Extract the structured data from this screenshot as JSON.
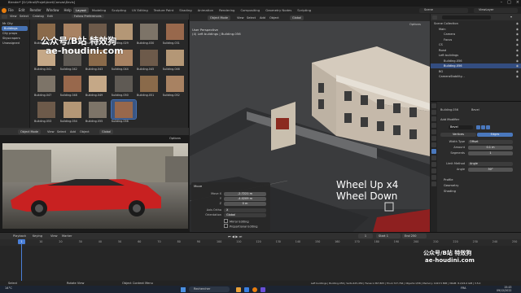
{
  "window": {
    "title": "Blender* [D:\\Vitrail\\Projet\\Anet\\Canvas\\Devis]"
  },
  "menu": {
    "items": [
      "File",
      "Edit",
      "Render",
      "Window",
      "Help"
    ],
    "workspaces": [
      "Layout",
      "Modeling",
      "Sculpting",
      "UV Editing",
      "Texture Paint",
      "Shading",
      "Animation",
      "Rendering",
      "Compositing",
      "Geometry Nodes",
      "Scripting"
    ],
    "active_workspace": "Layout",
    "scene": "Scene",
    "view_layer": "ViewLayer"
  },
  "asset_browser": {
    "header": [
      "View",
      "Select",
      "Catalog",
      "Edit"
    ],
    "library": "Follow Preferences",
    "library_dropdown": "Mr City",
    "catalogs": [
      "Buildings",
      "City props",
      "Skyscrapers",
      "Unassigned"
    ],
    "active_catalog": "Buildings",
    "thumbs": [
      {
        "label": "Building.026"
      },
      {
        "label": "Building.027"
      },
      {
        "label": "Building.028"
      },
      {
        "label": "Building.029"
      },
      {
        "label": "Building.030"
      },
      {
        "label": "Building.031"
      },
      {
        "label": "Building.041"
      },
      {
        "label": "Building.042"
      },
      {
        "label": "Building.043"
      },
      {
        "label": "Building.044"
      },
      {
        "label": "Building.045"
      },
      {
        "label": "Building.046"
      },
      {
        "label": "Building.047"
      },
      {
        "label": "Building.048"
      },
      {
        "label": "Building.049"
      },
      {
        "label": "Building.050"
      },
      {
        "label": "Building.051"
      },
      {
        "label": "Building.052"
      },
      {
        "label": "Building.053"
      },
      {
        "label": "Building.054"
      },
      {
        "label": "Building.055"
      },
      {
        "label": "Building.056"
      }
    ],
    "selected_thumb": "Building.056"
  },
  "video": {
    "mode": "Object Mode",
    "items": [
      "View",
      "Select",
      "Add",
      "Object"
    ],
    "transform": "Global",
    "options": "Options"
  },
  "viewport": {
    "mode": "Object Mode",
    "items": [
      "View",
      "Select",
      "Add",
      "Object"
    ],
    "transform": "Global",
    "options": "Options",
    "perspective": "User Perspective",
    "collection_info": "(4) Left buildings | Building.056",
    "overlay_text_1": "Wheel Up x4",
    "overlay_text_2": "Wheel Down"
  },
  "operator_panel": {
    "title": "Move",
    "move_x_label": "Move X",
    "move_x": "-2.7221 m",
    "move_y_label": "Y",
    "move_y": "-4.0209 m",
    "move_z_label": "Z",
    "move_z": "0 m",
    "axis_ortho_label": "Axis Ortho",
    "axis_ortho": "X",
    "orientation_label": "Orientation",
    "orientation": "Global",
    "mirror_editing": "Mirror Editing",
    "proportional_editing": "Proportional Editing"
  },
  "outliner": {
    "rows": [
      {
        "label": "Scene Collection",
        "indent": 0,
        "sel": false
      },
      {
        "label": "Main",
        "indent": 1,
        "sel": false
      },
      {
        "label": "Camera",
        "indent": 2,
        "sel": false
      },
      {
        "label": "Focus",
        "indent": 2,
        "sel": false
      },
      {
        "label": "CS",
        "indent": 1,
        "sel": false
      },
      {
        "label": "Road",
        "indent": 1,
        "sel": false
      },
      {
        "label": "Left buildings",
        "indent": 1,
        "sel": false
      },
      {
        "label": "Building.056",
        "indent": 2,
        "sel": false
      },
      {
        "label": "Building.056",
        "indent": 2,
        "sel": true
      },
      {
        "label": "BG",
        "indent": 1,
        "sel": false
      },
      {
        "label": "CameraStability...",
        "indent": 1,
        "sel": false
      }
    ]
  },
  "properties": {
    "object": "Building.056",
    "modifier_tab": "Bevel",
    "add_modifier": "Add Modifier",
    "modifier_name": "Bevel",
    "vertices_label": "Vertices",
    "edges_label": "Edges",
    "width_type_label": "Width Type",
    "width_type": "Offset",
    "amount_label": "Amount",
    "amount": "0.1 m",
    "segments_label": "Segments",
    "segments": "1",
    "limit_method_label": "Limit Method",
    "limit_method": "Angle",
    "angle_label": "Angle",
    "angle": "30°",
    "sections": [
      "Profile",
      "Geometry",
      "Shading"
    ]
  },
  "timeline": {
    "header": [
      "Playback",
      "Keying",
      "View",
      "Marker"
    ],
    "current_frame": "1",
    "start_label": "Start",
    "start": "1",
    "end_label": "End",
    "end": "250",
    "ticks": [
      "0",
      "10",
      "20",
      "30",
      "40",
      "50",
      "60",
      "70",
      "80",
      "90",
      "100",
      "110",
      "120",
      "130",
      "140",
      "150",
      "160",
      "170",
      "180",
      "190",
      "200",
      "210",
      "220",
      "230",
      "240",
      "250"
    ]
  },
  "status": {
    "left": "Select",
    "mid1": "Rotate View",
    "mid2": "Object Context Menu",
    "right": "Left buildings | Building.056 | Verts:425,450 | Faces:1,367,805 | Tris:2,727,764 | Objects:1/58 | Memory: 1023.5 MiB | VRAM: 8.2/24.0 GiB | 3.5.0"
  },
  "taskbar": {
    "search": "Rechercher",
    "weather": "14°C",
    "lang": "FRA",
    "time": "15:43",
    "date": "09/12/2022"
  },
  "watermark": {
    "line1": "公众号/B站 特效狗",
    "line2": "ae-houdini.com"
  }
}
